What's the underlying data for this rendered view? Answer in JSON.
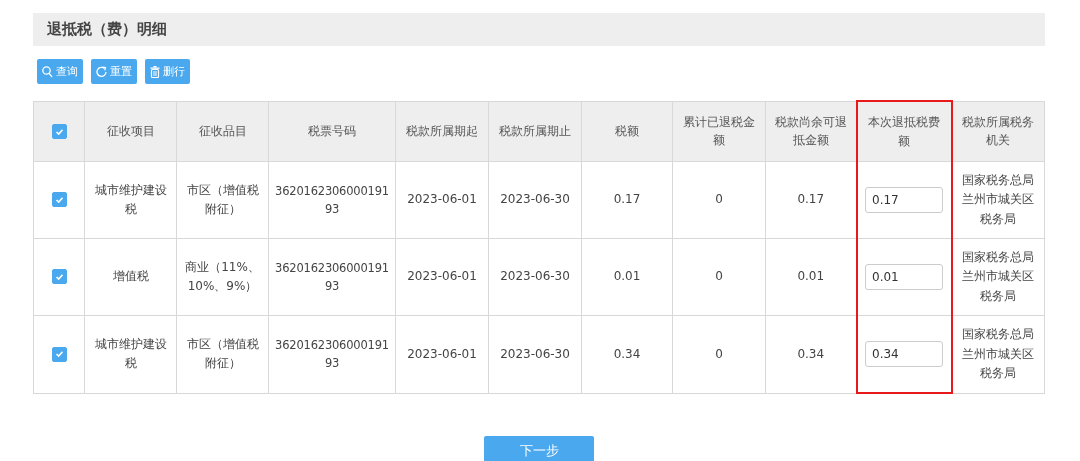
{
  "section_title": "退抵税（费）明细",
  "toolbar": [
    {
      "kind": "search",
      "label": "查询"
    },
    {
      "kind": "reset",
      "label": "重置"
    },
    {
      "kind": "delete",
      "label": "删行"
    }
  ],
  "table": {
    "select_all": {
      "checked": true
    },
    "columns": [
      {
        "label": "征收项目",
        "kind": "text",
        "highlighted": false
      },
      {
        "label": "征收品目",
        "kind": "text",
        "highlighted": false
      },
      {
        "label": "税票号码",
        "kind": "number",
        "highlighted": false
      },
      {
        "label": "税款所属期起",
        "kind": "text",
        "highlighted": false
      },
      {
        "label": "税款所属期止",
        "kind": "text",
        "highlighted": false
      },
      {
        "label": "税额",
        "kind": "text",
        "highlighted": false
      },
      {
        "label": "累计已退税金额",
        "kind": "text",
        "highlighted": false
      },
      {
        "label": "税款尚余可退抵金额",
        "kind": "text",
        "highlighted": false
      },
      {
        "label": "本次退抵税费额",
        "kind": "input",
        "highlighted": true
      },
      {
        "label": "税款所属税务机关",
        "kind": "agency",
        "highlighted": false
      }
    ],
    "rows": [
      {
        "checked": true,
        "cells": [
          "城市维护建设税",
          "市区（增值税附征）",
          "362016230600019193",
          "2023-06-01",
          "2023-06-30",
          "0.17",
          "0",
          "0.17",
          "0.17",
          "国家税务总局兰州市城关区税务局"
        ]
      },
      {
        "checked": true,
        "cells": [
          "增值税",
          "商业（11%、10%、9%）",
          "362016230600019193",
          "2023-06-01",
          "2023-06-30",
          "0.01",
          "0",
          "0.01",
          "0.01",
          "国家税务总局兰州市城关区税务局"
        ]
      },
      {
        "checked": true,
        "cells": [
          "城市维护建设税",
          "市区（增值税附征）",
          "362016230600019193",
          "2023-06-01",
          "2023-06-30",
          "0.34",
          "0",
          "0.34",
          "0.34",
          "国家税务总局兰州市城关区税务局"
        ]
      }
    ]
  },
  "next_button": "下一步"
}
